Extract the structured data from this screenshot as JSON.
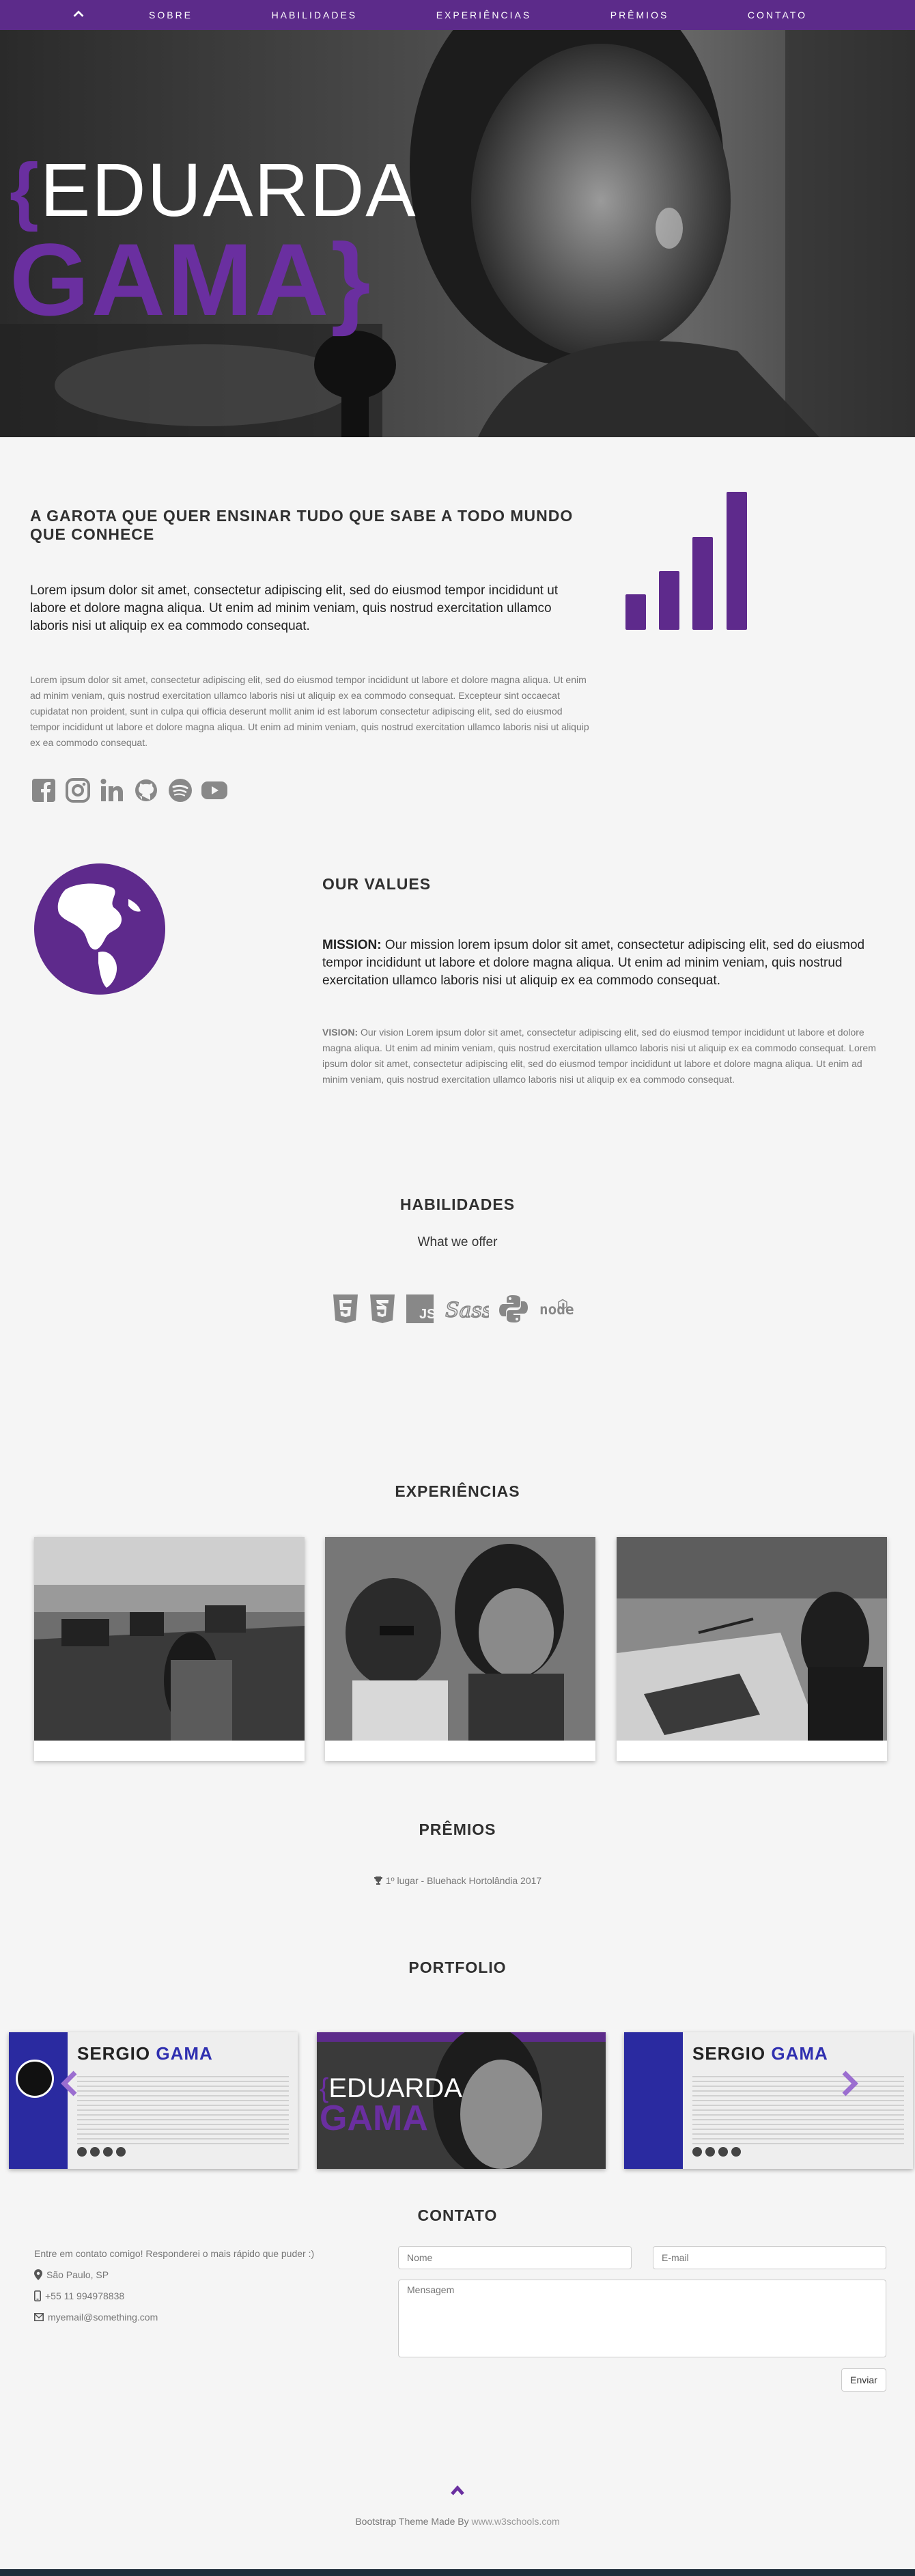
{
  "nav": {
    "home_icon": "chevron-up-icon",
    "items": [
      "SOBRE",
      "HABILIDADES",
      "EXPERIÊNCIAS",
      "PRÊMIOS",
      "CONTATO"
    ]
  },
  "hero": {
    "first_name": "EDUARDA",
    "last_name": "GAMA",
    "brace_open": "{",
    "brace_close": "}"
  },
  "about": {
    "title": "A GAROTA QUE QUER ENSINAR TUDO QUE SABE A TODO MUNDO QUE CONHECE",
    "lead": "Lorem ipsum dolor sit amet, consectetur adipiscing elit, sed do eiusmod tempor incididunt ut labore et dolore magna aliqua. Ut enim ad minim veniam, quis nostrud exercitation ullamco laboris nisi ut aliquip ex ea commodo consequat.",
    "body": "Lorem ipsum dolor sit amet, consectetur adipiscing elit, sed do eiusmod tempor incididunt ut labore et dolore magna aliqua. Ut enim ad minim veniam, quis nostrud exercitation ullamco laboris nisi ut aliquip ex ea commodo consequat. Excepteur sint occaecat cupidatat non proident, sunt in culpa qui officia deserunt mollit anim id est laborum consectetur adipiscing elit, sed do eiusmod tempor incididunt ut labore et dolore magna aliqua. Ut enim ad minim veniam, quis nostrud exercitation ullamco laboris nisi ut aliquip ex ea commodo consequat.",
    "icons": [
      "facebook-icon",
      "instagram-icon",
      "linkedin-icon",
      "github-icon",
      "spotify-icon",
      "youtube-icon"
    ],
    "signal_icon": "signal-bars-icon"
  },
  "values": {
    "title": "OUR VALUES",
    "mission_label": "MISSION:",
    "mission": "Our mission lorem ipsum dolor sit amet, consectetur adipiscing elit, sed do eiusmod tempor incididunt ut labore et dolore magna aliqua. Ut enim ad minim veniam, quis nostrud exercitation ullamco laboris nisi ut aliquip ex ea commodo consequat.",
    "vision_label": "VISION:",
    "vision": "Our vision Lorem ipsum dolor sit amet, consectetur adipiscing elit, sed do eiusmod tempor incididunt ut labore et dolore magna aliqua. Ut enim ad minim veniam, quis nostrud exercitation ullamco laboris nisi ut aliquip ex ea commodo consequat. Lorem ipsum dolor sit amet, consectetur adipiscing elit, sed do eiusmod tempor incididunt ut labore et dolore magna aliqua. Ut enim ad minim veniam, quis nostrud exercitation ullamco laboris nisi ut aliquip ex ea commodo consequat.",
    "globe_icon": "globe-icon"
  },
  "skills": {
    "title": "HABILIDADES",
    "subtitle": "What we offer",
    "icons": [
      "html5-icon",
      "css3-icon",
      "js-icon",
      "sass-icon",
      "python-icon",
      "node-icon"
    ],
    "sass_text": "Sass",
    "js_text": "JS",
    "node_text": "node"
  },
  "experiences": {
    "title": "EXPERIÊNCIAS"
  },
  "awards": {
    "title": "PRÊMIOS",
    "item": "1º lugar - Bluehack Hortolândia 2017",
    "trophy_icon": "trophy-icon"
  },
  "portfolio": {
    "title": "PORTFOLIO",
    "card1_first": "SERGIO",
    "card1_last": "GAMA",
    "card2_first": "EDUARDA",
    "card2_last": "GAMA",
    "card3_first": "SERGIO",
    "card3_last": "GAMA",
    "prev_icon": "chevron-left-icon",
    "next_icon": "chevron-right-icon"
  },
  "contact": {
    "title": "CONTATO",
    "intro": "Entre em contato comigo! Responderei o mais rápido que puder :)",
    "location": "São Paulo, SP",
    "phone": "+55 11 994978838",
    "email": "myemail@something.com",
    "name_placeholder": "Nome",
    "email_placeholder": "E-mail",
    "message_placeholder": "Mensagem",
    "send_label": "Enviar"
  },
  "footer": {
    "text": "Bootstrap Theme Made By ",
    "link": "www.w3schools.com",
    "top_icon": "chevron-up-icon"
  },
  "colors": {
    "accent": "#5c2b8a",
    "purple": "#6a2fa0"
  }
}
